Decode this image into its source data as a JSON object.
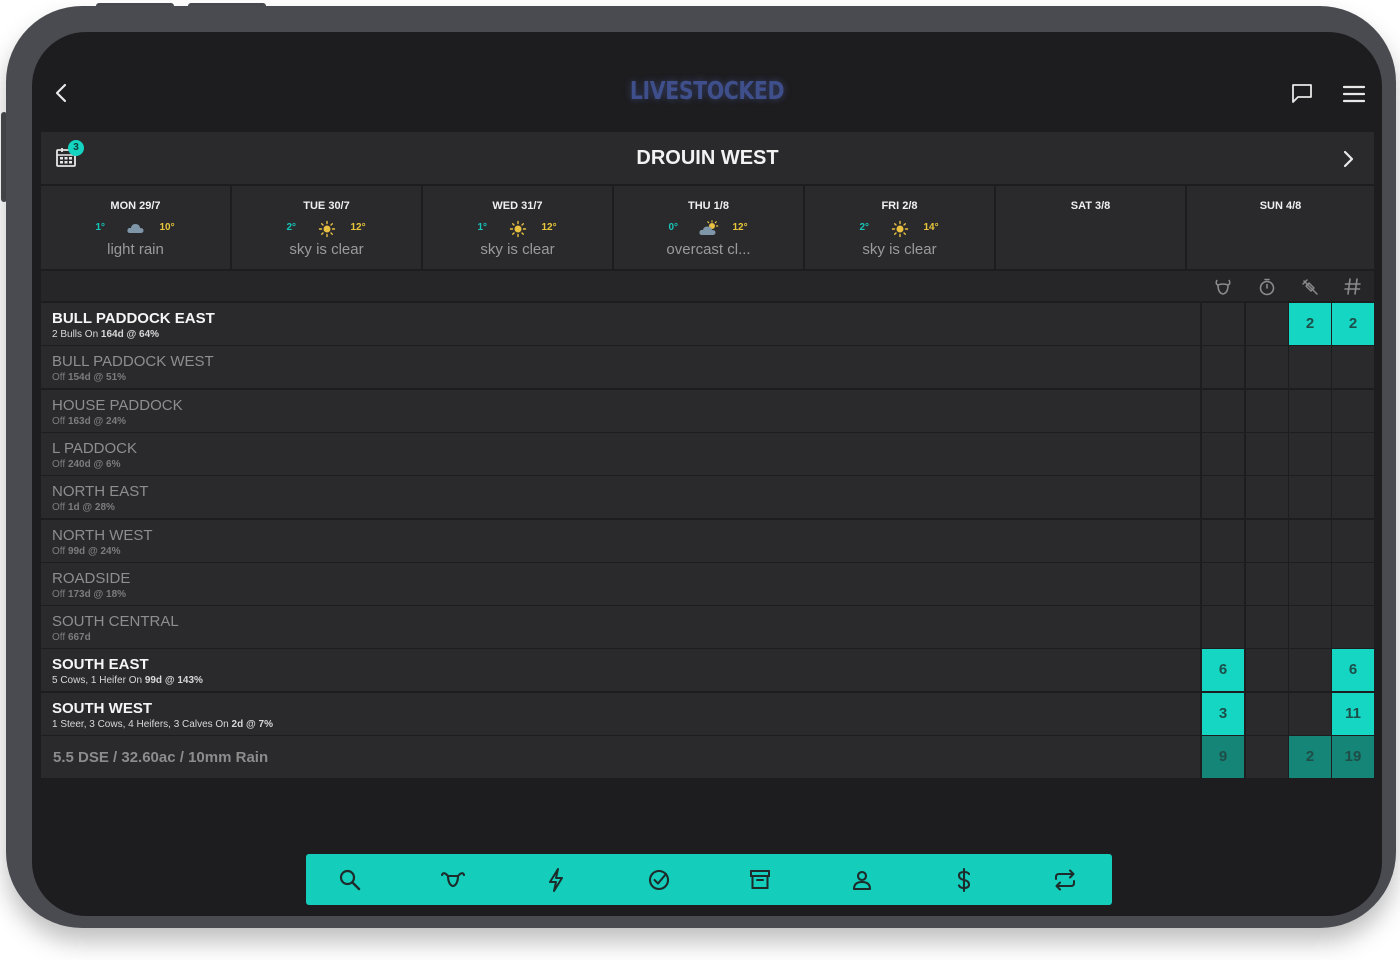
{
  "app": {
    "logo": "LIVESTOCKED"
  },
  "farm": {
    "name": "DROUIN WEST",
    "calendar_badge": "3"
  },
  "forecast": [
    {
      "day": "MON 29/7",
      "min": "1°",
      "max": "10°",
      "desc": "light rain",
      "icon": "rain-cloud-icon"
    },
    {
      "day": "TUE 30/7",
      "min": "2°",
      "max": "12°",
      "desc": "sky is clear",
      "icon": "sun-icon"
    },
    {
      "day": "WED 31/7",
      "min": "1°",
      "max": "12°",
      "desc": "sky is clear",
      "icon": "sun-icon"
    },
    {
      "day": "THU 1/8",
      "min": "0°",
      "max": "12°",
      "desc": "overcast cl...",
      "icon": "overcast-icon"
    },
    {
      "day": "FRI 2/8",
      "min": "2°",
      "max": "14°",
      "desc": "sky is clear",
      "icon": "sun-icon"
    },
    {
      "day": "SAT 3/8",
      "min": "",
      "max": "",
      "desc": "",
      "icon": ""
    },
    {
      "day": "SUN 4/8",
      "min": "",
      "max": "",
      "desc": "",
      "icon": ""
    }
  ],
  "columns": [
    "livestock-head-icon",
    "timer-icon",
    "syringe-icon",
    "hash-icon"
  ],
  "paddocks": [
    {
      "name": "BULL PADDOCK EAST",
      "active": true,
      "sub_pre": "2 Bulls On ",
      "sub_bold": "164d @ 64%",
      "cells": [
        "",
        "",
        "2",
        "2"
      ]
    },
    {
      "name": "BULL PADDOCK WEST",
      "active": false,
      "sub_pre": "Off ",
      "sub_bold": "154d @ 51%",
      "cells": [
        "",
        "",
        "",
        ""
      ]
    },
    {
      "name": "HOUSE PADDOCK",
      "active": false,
      "sub_pre": "Off ",
      "sub_bold": "163d @ 24%",
      "cells": [
        "",
        "",
        "",
        ""
      ]
    },
    {
      "name": "L PADDOCK",
      "active": false,
      "sub_pre": "Off ",
      "sub_bold": "240d @ 6%",
      "cells": [
        "",
        "",
        "",
        ""
      ]
    },
    {
      "name": "NORTH EAST",
      "active": false,
      "sub_pre": "Off ",
      "sub_bold": "1d @ 28%",
      "cells": [
        "",
        "",
        "",
        ""
      ]
    },
    {
      "name": "NORTH WEST",
      "active": false,
      "sub_pre": "Off ",
      "sub_bold": "99d @ 24%",
      "cells": [
        "",
        "",
        "",
        ""
      ]
    },
    {
      "name": "ROADSIDE",
      "active": false,
      "sub_pre": "Off ",
      "sub_bold": "173d @ 18%",
      "cells": [
        "",
        "",
        "",
        ""
      ]
    },
    {
      "name": "SOUTH CENTRAL",
      "active": false,
      "sub_pre": "Off ",
      "sub_bold": "667d",
      "cells": [
        "",
        "",
        "",
        ""
      ]
    },
    {
      "name": "SOUTH EAST",
      "active": true,
      "sub_pre": "5 Cows, 1 Heifer On ",
      "sub_bold": "99d @ 143%",
      "cells": [
        "6",
        "",
        "",
        "6"
      ]
    },
    {
      "name": "SOUTH WEST",
      "active": true,
      "sub_pre": "1 Steer, 3 Cows, 4 Heifers, 3 Calves On ",
      "sub_bold": "2d @ 7%",
      "cells": [
        "3",
        "",
        "",
        "11"
      ]
    }
  ],
  "summary": {
    "text": "5.5 DSE / 32.60ac / 10mm Rain",
    "cells": [
      "9",
      "",
      "2",
      "19"
    ]
  },
  "toolbar": [
    "search-icon",
    "cattle-icon",
    "lightning-icon",
    "check-circle-icon",
    "archive-icon",
    "user-icon",
    "dollar-icon",
    "repeat-icon"
  ],
  "colors": {
    "accent": "#14cdbb",
    "accent_dark": "#158577",
    "panel": "#2a2a2d",
    "screen_bg": "#1d1d1f"
  }
}
